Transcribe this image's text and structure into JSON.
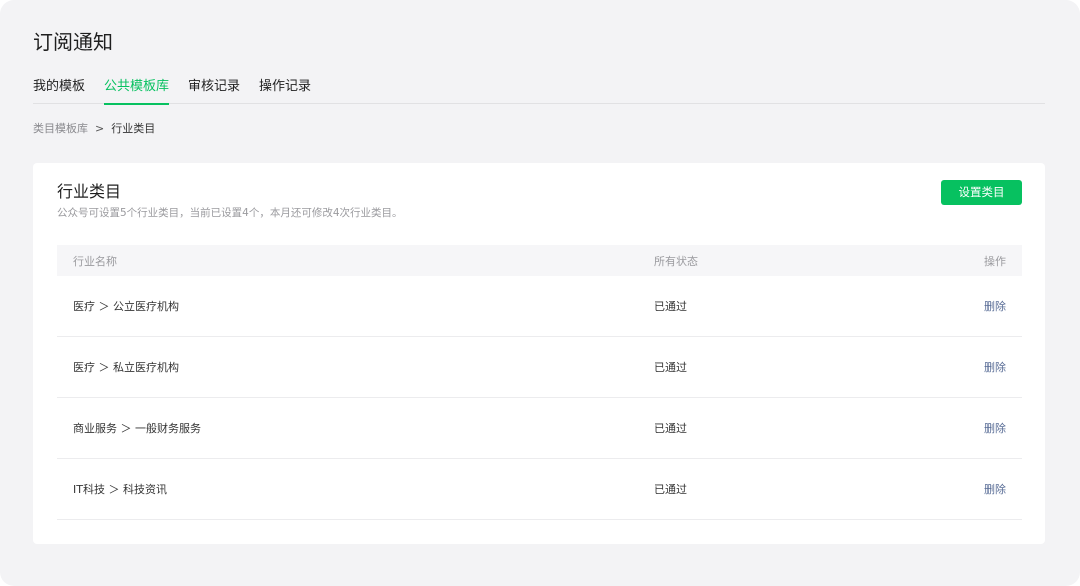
{
  "page": {
    "title": "订阅通知"
  },
  "tabs": [
    {
      "label": "我的模板",
      "active": false
    },
    {
      "label": "公共模板库",
      "active": true
    },
    {
      "label": "审核记录",
      "active": false
    },
    {
      "label": "操作记录",
      "active": false
    }
  ],
  "breadcrumb": {
    "parent": "类目模板库",
    "separator": ">",
    "current": "行业类目"
  },
  "card": {
    "title": "行业类目",
    "description": "公众号可设置5个行业类目，当前已设置4个，本月还可修改4次行业类目。",
    "action_button": "设置类目"
  },
  "table": {
    "headers": {
      "name": "行业名称",
      "status": "所有状态",
      "operation": "操作"
    },
    "rows": [
      {
        "name": "医疗 ＞ 公立医疗机构",
        "status": "已通过",
        "operation": "删除"
      },
      {
        "name": "医疗 ＞ 私立医疗机构",
        "status": "已通过",
        "operation": "删除"
      },
      {
        "name": "商业服务 ＞ 一般财务服务",
        "status": "已通过",
        "operation": "删除"
      },
      {
        "name": "IT科技 ＞ 科技资讯",
        "status": "已通过",
        "operation": "删除"
      }
    ]
  },
  "colors": {
    "accent": "#07c160",
    "link": "#576b95",
    "background": "#f3f3f5"
  }
}
